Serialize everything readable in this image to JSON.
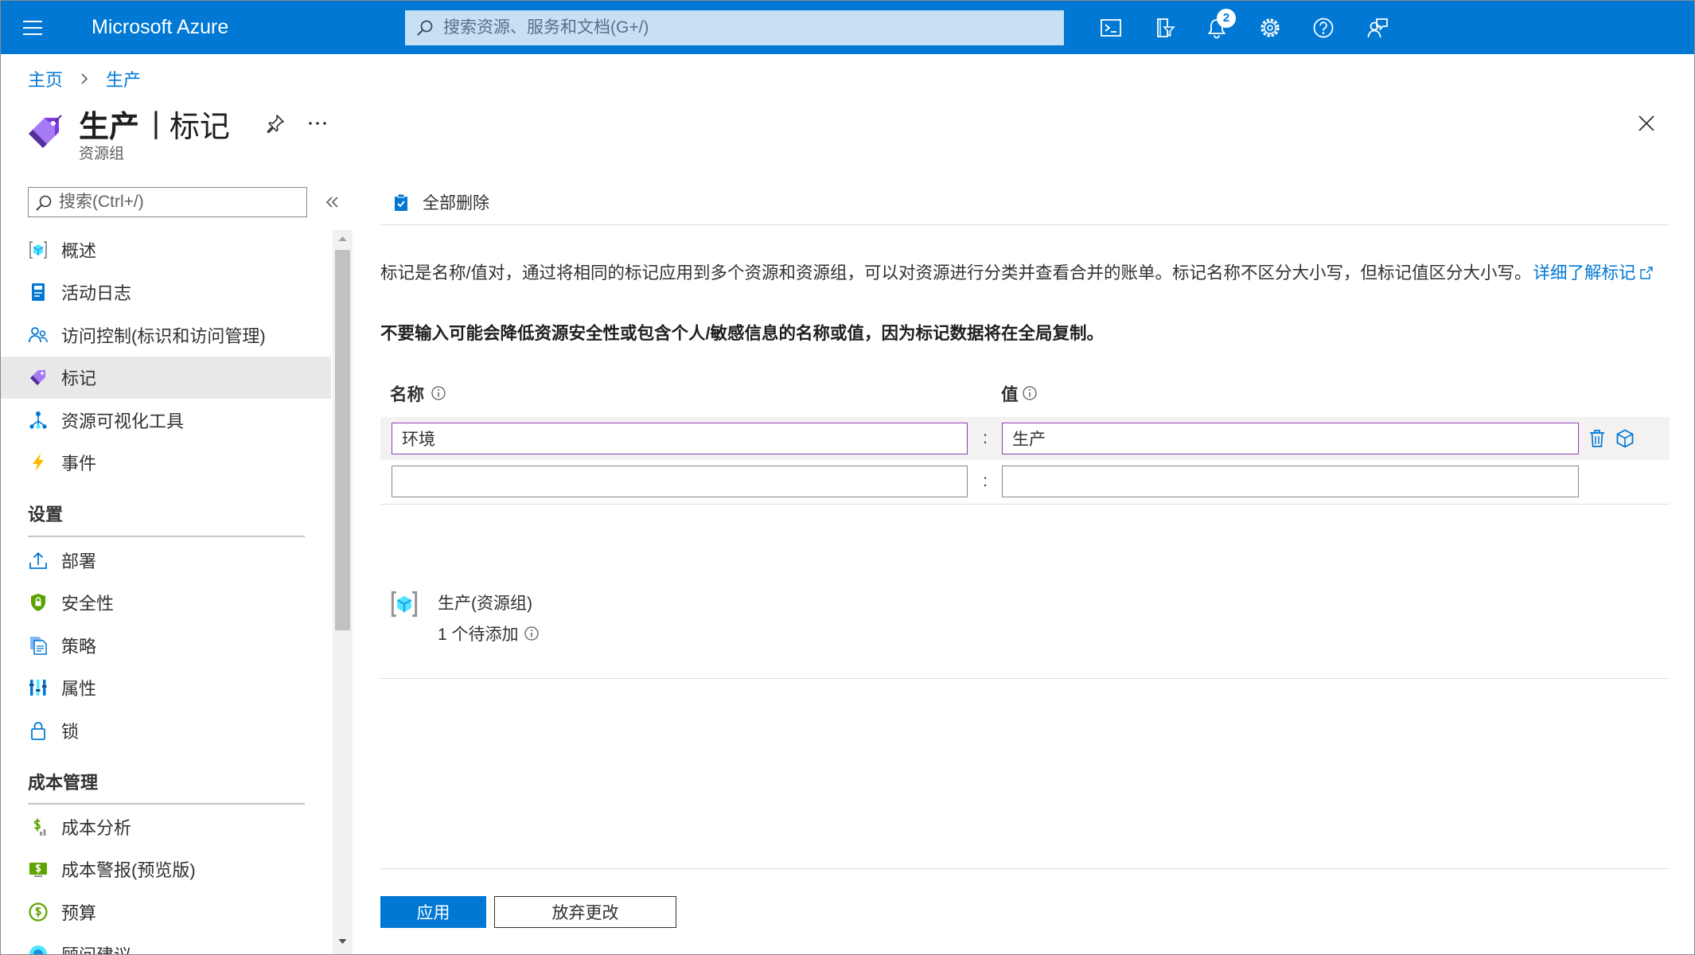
{
  "topbar": {
    "brand": "Microsoft Azure",
    "search_placeholder": "搜索资源、服务和文档(G+/)",
    "notification_count": "2",
    "icons": [
      "menu-icon",
      "search-icon",
      "cloud-shell-icon",
      "directory-filter-icon",
      "notifications-icon",
      "settings-icon",
      "help-icon",
      "feedback-icon"
    ]
  },
  "breadcrumb": {
    "home": "主页",
    "current": "生产"
  },
  "header": {
    "title": "生产",
    "title_separator": "|",
    "page": "标记",
    "resource_type": "资源组",
    "icons": [
      "tag-icon",
      "pin-icon",
      "more-icon",
      "close-icon"
    ]
  },
  "sidebar": {
    "search_placeholder": "搜索(Ctrl+/)",
    "items": [
      {
        "label": "概述",
        "icon": "resource-group-icon"
      },
      {
        "label": "活动日志",
        "icon": "activity-log-icon"
      },
      {
        "label": "访问控制(标识和访问管理)",
        "icon": "access-control-icon"
      },
      {
        "label": "标记",
        "icon": "tag-icon",
        "selected": true
      },
      {
        "label": "资源可视化工具",
        "icon": "resource-visualizer-icon"
      },
      {
        "label": "事件",
        "icon": "events-icon"
      }
    ],
    "settings": {
      "title": "设置",
      "items": [
        {
          "label": "部署",
          "icon": "deployments-icon"
        },
        {
          "label": "安全性",
          "icon": "security-icon"
        },
        {
          "label": "策略",
          "icon": "policy-icon"
        },
        {
          "label": "属性",
          "icon": "properties-icon"
        },
        {
          "label": "锁",
          "icon": "lock-icon"
        }
      ]
    },
    "cost_management": {
      "title": "成本管理",
      "items": [
        {
          "label": "成本分析",
          "icon": "cost-analysis-icon"
        },
        {
          "label": "成本警报(预览版)",
          "icon": "cost-alerts-icon"
        },
        {
          "label": "预算",
          "icon": "budgets-icon"
        },
        {
          "label": "顾问建议",
          "icon": "advisor-icon"
        }
      ]
    }
  },
  "toolbar": {
    "delete_all": "全部删除"
  },
  "description": {
    "text": "标记是名称/值对，通过将相同的标记应用到多个资源和资源组，可以对资源进行分类并查看合并的账单。标记名称不区分大小写，但标记值区分大小写。",
    "learn_more": "详细了解标记"
  },
  "warning": "不要输入可能会降低资源安全性或包含个人/敏感信息的名称或值，因为标记数据将在全局复制。",
  "tags_table": {
    "name_header": "名称",
    "value_header": "值",
    "separator": ":",
    "rows": [
      {
        "name": "环境",
        "value": "生产"
      },
      {
        "name": "",
        "value": ""
      }
    ]
  },
  "resource": {
    "name": "生产(资源组)",
    "pending": "1 个待添加"
  },
  "actions": {
    "apply": "应用",
    "discard": "放弃更改"
  },
  "colors": {
    "accent": "#0078d4",
    "search_box": "#c7e0f4",
    "active_input_border": "#8b3fb5",
    "selected_row": "#f3f2f1",
    "selected_nav": "#e9e9e9"
  }
}
